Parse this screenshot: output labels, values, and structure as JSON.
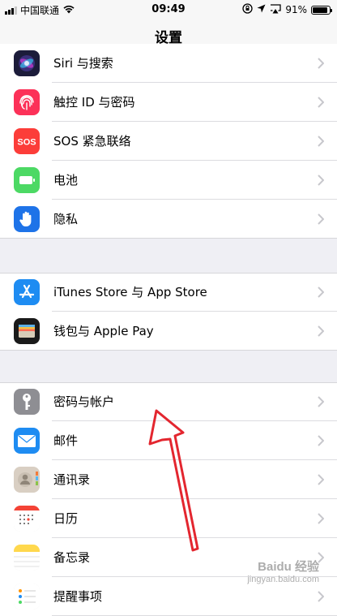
{
  "status_bar": {
    "carrier": "中国联通",
    "time": "09:49",
    "battery_percent": "91%",
    "battery_level": 0.91,
    "icons": [
      "signal-icon",
      "wifi-icon",
      "rotation-lock-icon",
      "location-icon",
      "airplay-icon",
      "battery-icon"
    ]
  },
  "nav": {
    "title": "设置"
  },
  "groups": [
    [
      {
        "id": "siri",
        "label": "Siri 与搜索",
        "icon": "siri-icon",
        "color": "#1c1c3a"
      },
      {
        "id": "touch-id",
        "label": "触控 ID 与密码",
        "icon": "fingerprint-icon",
        "color": "#fc3158"
      },
      {
        "id": "sos",
        "label": "SOS 紧急联络",
        "icon": "sos-icon",
        "color": "#fc3d39",
        "badge_text": "SOS"
      },
      {
        "id": "battery",
        "label": "电池",
        "icon": "battery-app-icon",
        "color": "#4cd964"
      },
      {
        "id": "privacy",
        "label": "隐私",
        "icon": "hand-icon",
        "color": "#1e73e8"
      }
    ],
    [
      {
        "id": "app-store",
        "label": "iTunes Store 与 App Store",
        "icon": "app-store-icon",
        "color": "#1e8cf2"
      },
      {
        "id": "wallet",
        "label": "钱包与 Apple Pay",
        "icon": "wallet-icon",
        "color": "#1a1a1a"
      }
    ],
    [
      {
        "id": "passwords",
        "label": "密码与帐户",
        "icon": "key-icon",
        "color": "#8e8e93"
      },
      {
        "id": "mail",
        "label": "邮件",
        "icon": "mail-icon",
        "color": "#1e8cf2"
      },
      {
        "id": "contacts",
        "label": "通讯录",
        "icon": "contacts-icon",
        "color": "#d9cfc3"
      },
      {
        "id": "calendar",
        "label": "日历",
        "icon": "calendar-icon",
        "color": "#ffffff"
      },
      {
        "id": "notes",
        "label": "备忘录",
        "icon": "notes-icon",
        "color": "#ffd84d"
      },
      {
        "id": "reminders",
        "label": "提醒事项",
        "icon": "reminders-icon",
        "color": "#ffffff"
      }
    ]
  ],
  "annotation": {
    "icon": "red-arrow-icon",
    "color": "#e3262f"
  },
  "watermark": {
    "main": "Baidu 经验",
    "sub": "jingyan.baidu.com"
  }
}
